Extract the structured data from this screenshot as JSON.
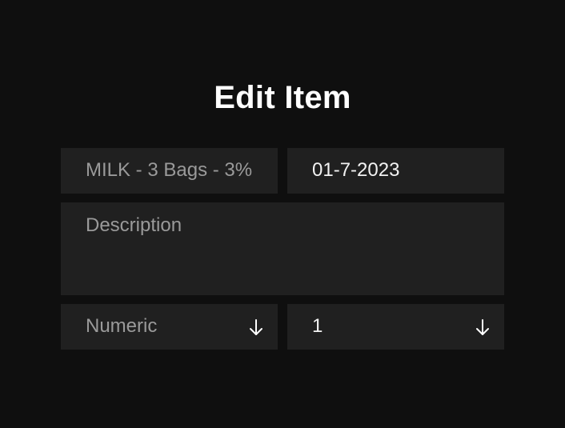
{
  "title": "Edit Item",
  "fields": {
    "name": {
      "value": "MILK - 3 Bags - 3%"
    },
    "date": {
      "value": "01-7-2023"
    },
    "description": {
      "placeholder": "Description"
    },
    "unit": {
      "placeholder": "Numeric",
      "icon": "arrow-down-icon"
    },
    "quantity": {
      "value": "1",
      "icon": "arrow-down-icon"
    }
  },
  "colors": {
    "background": "#0f0f0f",
    "field_bg": "#202020",
    "text_primary": "#f2f2f2",
    "text_placeholder": "#9a9a9a"
  }
}
